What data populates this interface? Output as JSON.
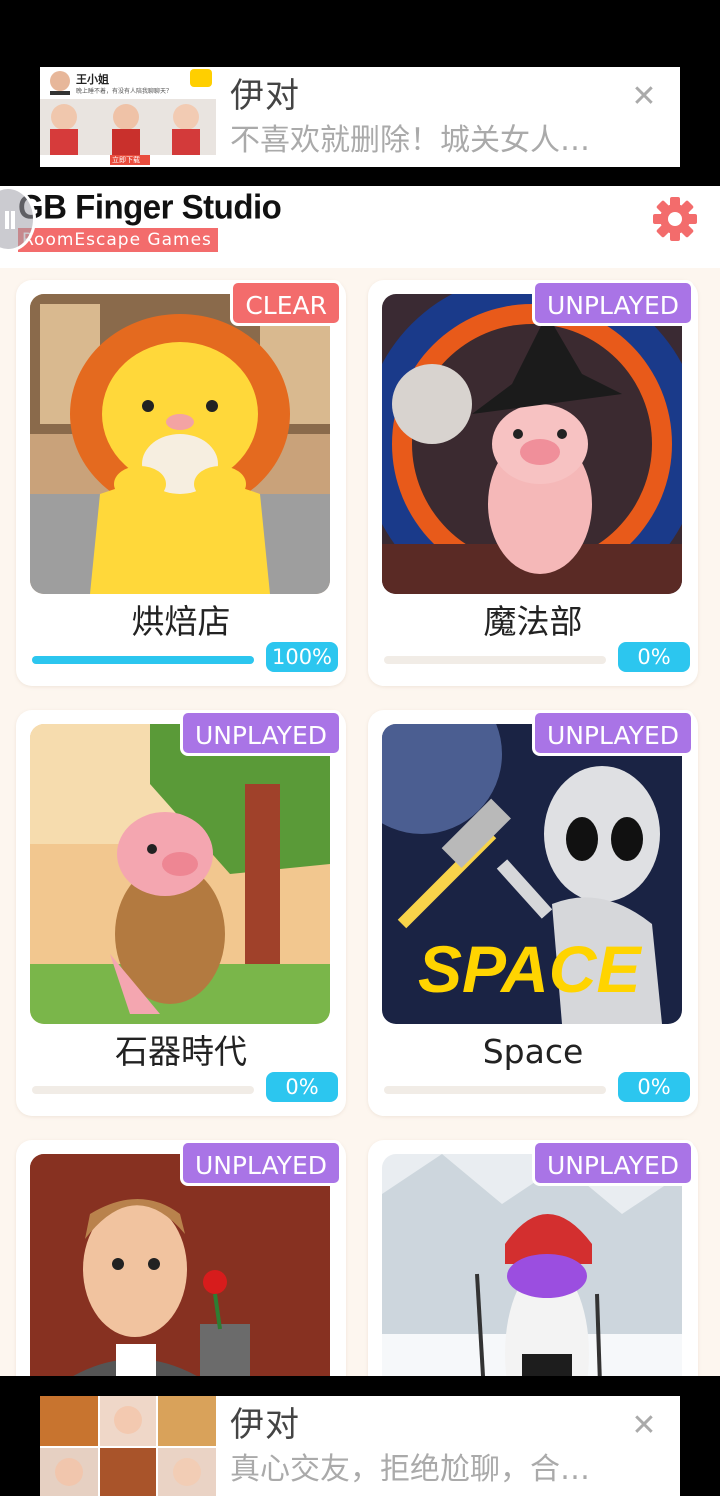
{
  "ads": {
    "top": {
      "title": "伊对",
      "description": "不喜欢就删除！城关女人…",
      "thumb_name": "王小姐",
      "thumb_caption": "晚上睡不着，有没有人陪我聊聊天？",
      "thumb_button": "立即下载"
    },
    "bottom": {
      "title": "伊对",
      "description": "真心交友，拒绝尬聊，合…"
    }
  },
  "header": {
    "brand_title": "GB Finger Studio",
    "brand_subtitle": "RoomEscape  Games",
    "settings_icon": "gear-icon"
  },
  "games": [
    {
      "title": "烘焙店",
      "badge": "CLEAR",
      "progress": 100,
      "progress_label": "100%",
      "art": "lion-bakery"
    },
    {
      "title": "魔法部",
      "badge": "UNPLAYED",
      "progress": 0,
      "progress_label": "0%",
      "art": "pig-wizard"
    },
    {
      "title": "石器時代",
      "badge": "UNPLAYED",
      "progress": 0,
      "progress_label": "0%",
      "art": "pig-caveman"
    },
    {
      "title": "Space",
      "badge": "UNPLAYED",
      "progress": 0,
      "progress_label": "0%",
      "art": "alien-space",
      "art_text": "SPACE"
    },
    {
      "title": "",
      "badge": "UNPLAYED",
      "progress": 0,
      "progress_label": "",
      "art": "waiter-rose"
    },
    {
      "title": "",
      "badge": "UNPLAYED",
      "progress": 0,
      "progress_label": "",
      "art": "panda-ski"
    }
  ],
  "colors": {
    "clear": "#f36c6c",
    "unplayed": "#a974e6",
    "progress": "#2cc6ef",
    "accent": "#f36c6c"
  }
}
